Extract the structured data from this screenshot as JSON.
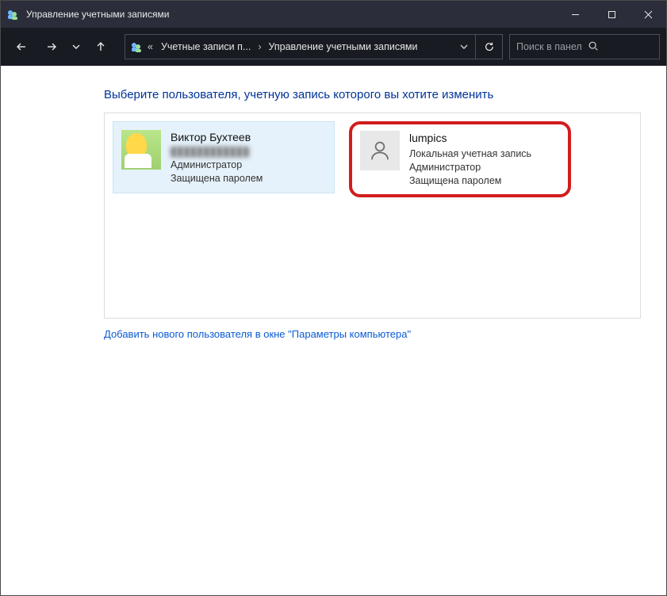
{
  "window": {
    "title": "Управление учетными записями"
  },
  "breadcrumb": {
    "back_chevrons": "«",
    "seg1": "Учетные записи п...",
    "seg2": "Управление учетными записями"
  },
  "search": {
    "placeholder": "Поиск в панели упра..."
  },
  "content": {
    "heading": "Выберите пользователя, учетную запись которого вы хотите изменить",
    "add_link": "Добавить нового пользователя в окне \"Параметры компьютера\""
  },
  "users": [
    {
      "name": "Виктор Бухтеев",
      "email_masked": "████████████",
      "line1": "Администратор",
      "line2": "Защищена паролем"
    },
    {
      "name": "lumpics",
      "line1": "Локальная учетная запись",
      "line2": "Администратор",
      "line3": "Защищена паролем"
    }
  ]
}
